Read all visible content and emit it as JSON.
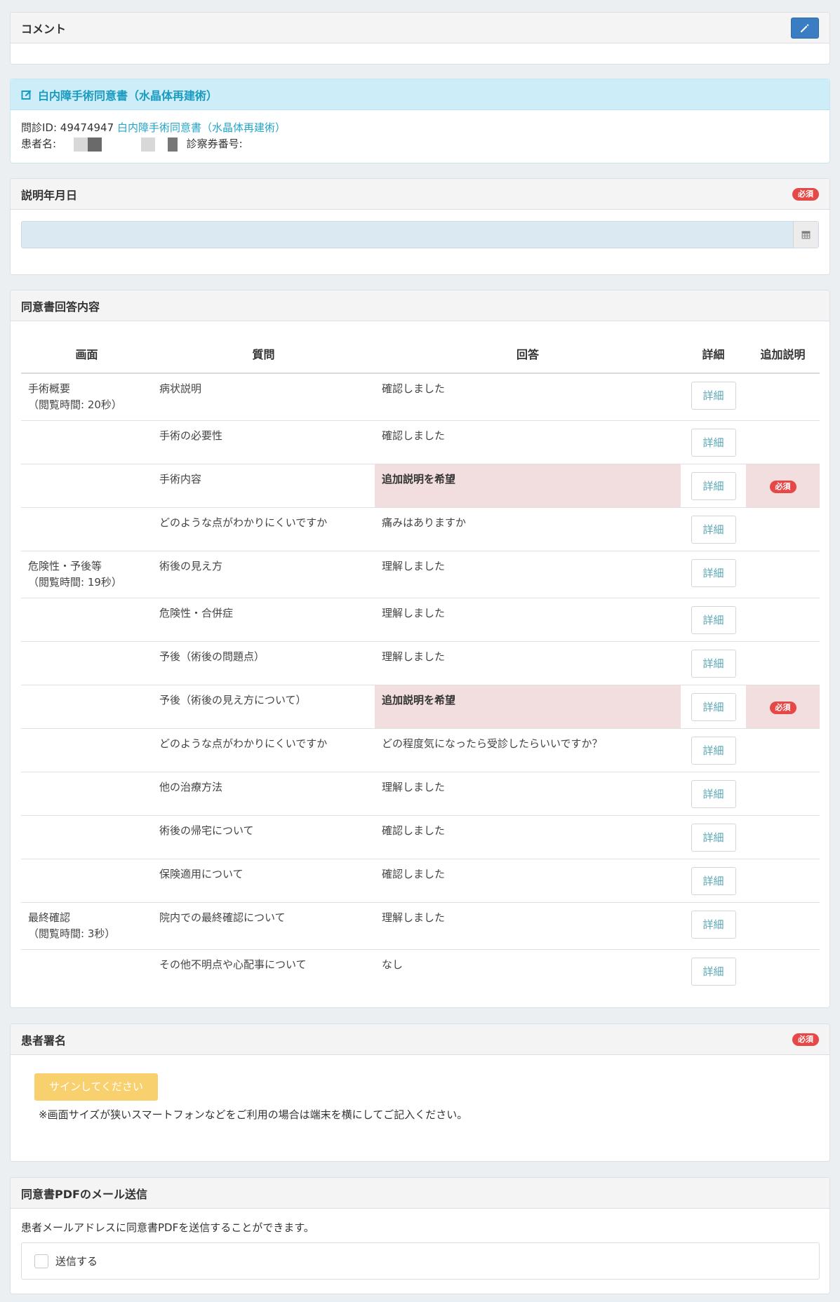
{
  "comment": {
    "title": "コメント",
    "edit_icon": "pencil-icon"
  },
  "consent": {
    "title": "白内障手術同意書（水晶体再建術）",
    "id_label": "問診ID: 49474947",
    "id_link": "白内障手術同意書（水晶体再建術）",
    "patient_label": "患者名:",
    "card_label": "診察券番号:"
  },
  "date_section": {
    "title": "説明年月日",
    "required": "必須",
    "value": ""
  },
  "answers": {
    "title": "同意書回答内容",
    "headers": [
      "画面",
      "質問",
      "回答",
      "詳細",
      "追加説明"
    ],
    "detail_label": "詳細",
    "required": "必須",
    "rows": [
      {
        "screen": "手術概要",
        "screen_time": "（閲覧時間: 20秒）",
        "question": "病状説明",
        "answer": "確認しました"
      },
      {
        "question": "手術の必要性",
        "answer": "確認しました"
      },
      {
        "question": "手術内容",
        "answer": "追加説明を希望"
      },
      {
        "question": "どのような点がわかりにくいですか",
        "answer": "痛みはありますか"
      },
      {
        "screen": "危険性・予後等",
        "screen_time": "（閲覧時間: 19秒）",
        "question": "術後の見え方",
        "answer": "理解しました"
      },
      {
        "question": "危険性・合併症",
        "answer": "理解しました"
      },
      {
        "question": "予後（術後の問題点）",
        "answer": "理解しました"
      },
      {
        "question": "予後（術後の見え方について）",
        "answer": "追加説明を希望"
      },
      {
        "question": "どのような点がわかりにくいですか",
        "answer": "どの程度気になったら受診したらいいですか？"
      },
      {
        "question": "他の治療方法",
        "answer": "理解しました"
      },
      {
        "question": "術後の帰宅について",
        "answer": "確認しました"
      },
      {
        "question": "保険適用について",
        "answer": "確認しました"
      },
      {
        "screen": "最終確認",
        "screen_time": "（閲覧時間: 3秒）",
        "question": "院内での最終確認について",
        "answer": "理解しました"
      },
      {
        "question": "その他不明点や心配事について",
        "answer": "なし"
      }
    ]
  },
  "signature": {
    "title": "患者署名",
    "required": "必須",
    "button": "サインしてください",
    "note": "※画面サイズが狭いスマートフォンなどをご利用の場合は端末を横にしてご記入ください。"
  },
  "mail": {
    "title": "同意書PDFのメール送信",
    "desc": "患者メールアドレスに同意書PDFを送信することができます。",
    "checkbox_label": "送信する"
  },
  "colors": {
    "accent": "#3a7dc2",
    "required": "#e64848",
    "highlight": "#f2dede",
    "sign": "#f9d06e"
  }
}
